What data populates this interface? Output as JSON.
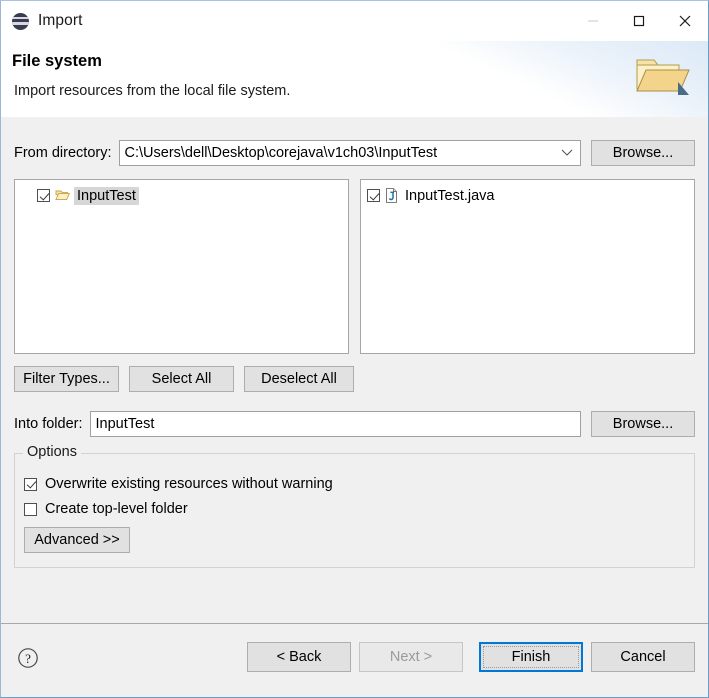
{
  "window": {
    "title": "Import",
    "app_icon": "eclipse-icon",
    "controls": {
      "minimize": "minimize-icon",
      "maximize": "maximize-icon",
      "close": "close-icon"
    }
  },
  "header": {
    "title": "File system",
    "description": "Import resources from the local file system.",
    "banner_icon": "open-folder-icon"
  },
  "from_directory": {
    "label": "From directory:",
    "value": "C:\\Users\\dell\\Desktop\\corejava\\v1ch03\\InputTest",
    "placeholder": "",
    "dropdown_icon": "chevron-down-icon",
    "browse_label": "Browse..."
  },
  "tree_panel": {
    "items": [
      {
        "label": "InputTest",
        "checked": true,
        "selected": true,
        "icon": "open-folder-icon"
      }
    ]
  },
  "file_panel": {
    "items": [
      {
        "label": "InputTest.java",
        "checked": true,
        "icon": "java-file-icon"
      }
    ]
  },
  "filter_buttons": {
    "filter_types": "Filter Types...",
    "select_all": "Select All",
    "deselect_all": "Deselect All"
  },
  "into_folder": {
    "label": "Into folder:",
    "value": "InputTest",
    "placeholder": "",
    "browse_label": "Browse..."
  },
  "options": {
    "group_title": "Options",
    "items": [
      {
        "label": "Overwrite existing resources without warning",
        "checked": true
      },
      {
        "label": "Create top-level folder",
        "checked": false
      }
    ],
    "advanced_label": "Advanced >>"
  },
  "footer": {
    "help_icon": "help-icon",
    "back_label": "< Back",
    "next_label": "Next >",
    "next_enabled": false,
    "finish_label": "Finish",
    "cancel_label": "Cancel"
  },
  "colors": {
    "accent": "#0078d7",
    "dialog_bg": "#f0f0f0",
    "field_bg": "#ffffff",
    "button_bg": "#e1e1e1",
    "folder_yellow": "#f5d98a",
    "selection_gray": "#d6d6d6"
  }
}
